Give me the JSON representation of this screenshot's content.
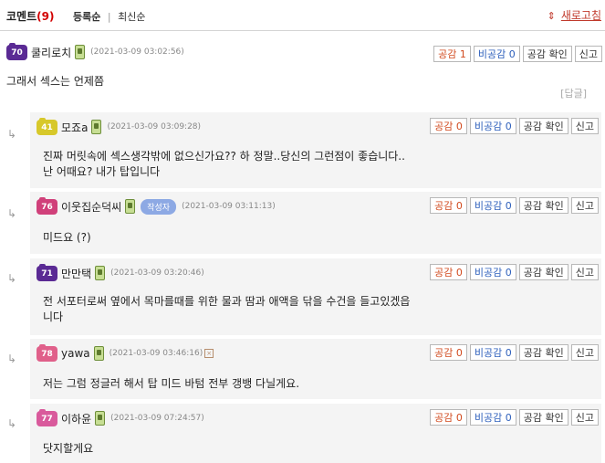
{
  "header": {
    "title": "코멘트",
    "count": "(9)",
    "sort_registered": "등록순",
    "sep": "|",
    "sort_latest": "최신순",
    "refresh_icon": "⇕",
    "refresh_label": "새로고침"
  },
  "buttons": {
    "like_prefix": "공감",
    "dislike_prefix": "비공감",
    "confirm": "공감 확인",
    "report": "신고"
  },
  "reply_link": "[답글]",
  "reply_arrow": "↳",
  "comments": [
    {
      "level": "70",
      "level_color": "#5a2a94",
      "nick": "쿨리로치",
      "date": "(2021-03-09 03:02:56)",
      "like": "1",
      "dislike": "0",
      "text": "그래서 섹스는 언제쯤"
    },
    {
      "level": "41",
      "level_color": "#d7c82a",
      "nick": "모죠a",
      "date": "(2021-03-09 03:09:28)",
      "like": "0",
      "dislike": "0",
      "text": "진짜 머릿속에 섹스생각밖에 없으신가요?? 하 정말..당신의 그런점이 좋습니다..",
      "text2": "난 어때요? 내가 탑입니다"
    },
    {
      "level": "76",
      "level_color": "#d0407a",
      "nick": "이웃집순덕씨",
      "badge": "작성자",
      "date": "(2021-03-09 03:11:13)",
      "like": "0",
      "dislike": "0",
      "text": "미드요 (?)"
    },
    {
      "level": "71",
      "level_color": "#5a2a94",
      "nick": "만만택",
      "date": "(2021-03-09 03:20:46)",
      "like": "0",
      "dislike": "0",
      "text": "전 서포터로써 옆에서 목마를때를 위한 물과 땀과 애액을 닦을 수건을 들고있겠읍",
      "text2": "니다"
    },
    {
      "level": "78",
      "level_color": "#e0608a",
      "nick": "yawa",
      "date": "(2021-03-09 03:46:16)",
      "like": "0",
      "dislike": "0",
      "text": "저는 그럼 정글러 해서 탑 미드 바텀 전부 갱뱅 다닐게요."
    },
    {
      "level": "77",
      "level_color": "#d95a9c",
      "nick": "이하윤",
      "date": "(2021-03-09 07:24:57)",
      "like": "0",
      "dislike": "0",
      "text": "닷지할게요"
    }
  ]
}
